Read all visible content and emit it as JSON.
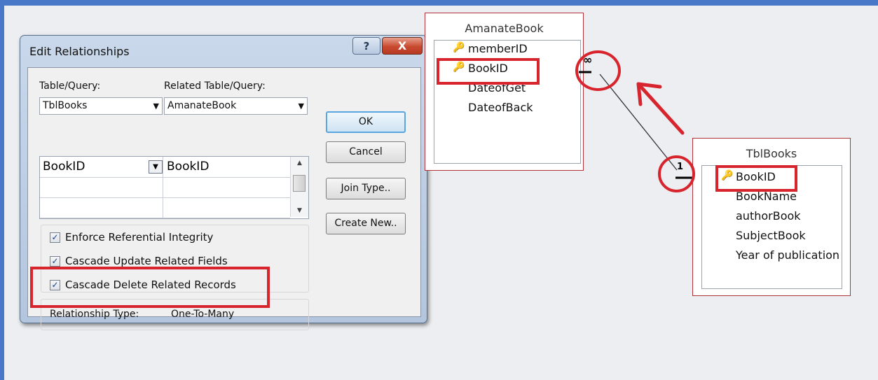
{
  "dialog": {
    "title": "Edit Relationships",
    "help_button": "?",
    "close_button": "X",
    "table_query_label": "Table/Query:",
    "related_table_query_label": "Related Table/Query:",
    "table_query_value": "TblBooks",
    "related_table_query_value": "AmanateBook",
    "grid_rows": [
      {
        "field": "BookID",
        "related_field": "BookID"
      },
      {
        "field": "",
        "related_field": ""
      },
      {
        "field": "",
        "related_field": ""
      }
    ],
    "buttons": {
      "ok": "OK",
      "cancel": "Cancel",
      "join_type": "Join Type..",
      "create_new": "Create New.."
    },
    "checkboxes": [
      {
        "label": "Enforce Referential Integrity",
        "checked": true
      },
      {
        "label": "Cascade Update Related Fields",
        "checked": true
      },
      {
        "label": "Cascade Delete Related Records",
        "checked": true
      }
    ],
    "relationship_type_label": "Relationship Type:",
    "relationship_type_value": "One-To-Many"
  },
  "tables": {
    "amanate": {
      "title": "AmanateBook",
      "fields": [
        "memberID",
        "BookID",
        "DateofGet",
        "DateofBack"
      ],
      "keys": [
        true,
        true,
        false,
        false
      ]
    },
    "tblbooks": {
      "title": "TblBooks",
      "fields": [
        "BookID",
        "BookName",
        "authorBook",
        "SubjectBook",
        "Year of publication"
      ],
      "keys": [
        true,
        false,
        false,
        false,
        false
      ]
    }
  },
  "relationship": {
    "many_symbol": "∞",
    "one_symbol": "1"
  },
  "colors": {
    "highlight_red": "#d7242d",
    "desktop_blue": "#4a78c8"
  }
}
